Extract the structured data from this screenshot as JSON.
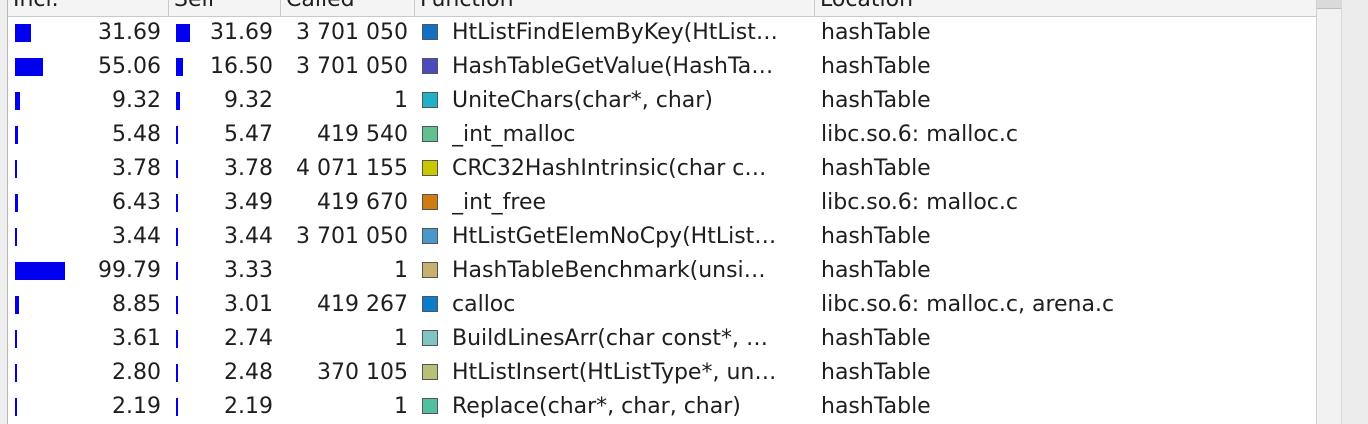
{
  "columns": {
    "incl": "Incl.",
    "self": "Self",
    "called": "Called",
    "function": "Function",
    "location": "Location"
  },
  "rows": [
    {
      "incl": "31.69",
      "self": "31.69",
      "called": "3 701 050",
      "function": "HtListFindElemByKey(HtList…",
      "location": "hashTable",
      "color": "#1270c4",
      "incl_bar": 0.3169,
      "self_bar": 0.3169
    },
    {
      "incl": "55.06",
      "self": "16.50",
      "called": "3 701 050",
      "function": "HashTableGetValue(HashTa…",
      "location": "hashTable",
      "color": "#4b4bbd",
      "incl_bar": 0.5506,
      "self_bar": 0.165
    },
    {
      "incl": "9.32",
      "self": "9.32",
      "called": "1",
      "function": "UniteChars(char*, char)",
      "location": "hashTable",
      "color": "#20b0c8",
      "incl_bar": 0.0932,
      "self_bar": 0.0932
    },
    {
      "incl": "5.48",
      "self": "5.47",
      "called": "419 540",
      "function": "_int_malloc",
      "location": "libc.so.6: malloc.c",
      "color": "#60c090",
      "incl_bar": 0.0548,
      "self_bar": 0.0547
    },
    {
      "incl": "3.78",
      "self": "3.78",
      "called": "4 071 155",
      "function": "CRC32HashIntrinsic(char c…",
      "location": "hashTable",
      "color": "#c8c800",
      "incl_bar": 0.0378,
      "self_bar": 0.0378
    },
    {
      "incl": "6.43",
      "self": "3.49",
      "called": "419 670",
      "function": "_int_free",
      "location": "libc.so.6: malloc.c",
      "color": "#d07c10",
      "incl_bar": 0.0643,
      "self_bar": 0.0349
    },
    {
      "incl": "3.44",
      "self": "3.44",
      "called": "3 701 050",
      "function": "HtListGetElemNoCpy(HtList…",
      "location": "hashTable",
      "color": "#4898cc",
      "incl_bar": 0.0344,
      "self_bar": 0.0344
    },
    {
      "incl": "99.79",
      "self": "3.33",
      "called": "1",
      "function": "HashTableBenchmark(unsi…",
      "location": "hashTable",
      "color": "#c8b070",
      "incl_bar": 0.9979,
      "self_bar": 0.0333
    },
    {
      "incl": "8.85",
      "self": "3.01",
      "called": "419 267",
      "function": "calloc",
      "location": "libc.so.6: malloc.c, arena.c",
      "color": "#0c7ccc",
      "incl_bar": 0.0885,
      "self_bar": 0.0301
    },
    {
      "incl": "3.61",
      "self": "2.74",
      "called": "1",
      "function": "BuildLinesArr(char const*, …",
      "location": "hashTable",
      "color": "#80c4c4",
      "incl_bar": 0.0361,
      "self_bar": 0.0274
    },
    {
      "incl": "2.80",
      "self": "2.48",
      "called": "370 105",
      "function": "HtListInsert(HtListType*, un…",
      "location": "hashTable",
      "color": "#b8c078",
      "incl_bar": 0.028,
      "self_bar": 0.0248
    },
    {
      "incl": "2.19",
      "self": "2.19",
      "called": "1",
      "function": "Replace(char*, char, char)",
      "location": "hashTable",
      "color": "#50c0a0",
      "incl_bar": 0.0219,
      "self_bar": 0.0219
    }
  ]
}
